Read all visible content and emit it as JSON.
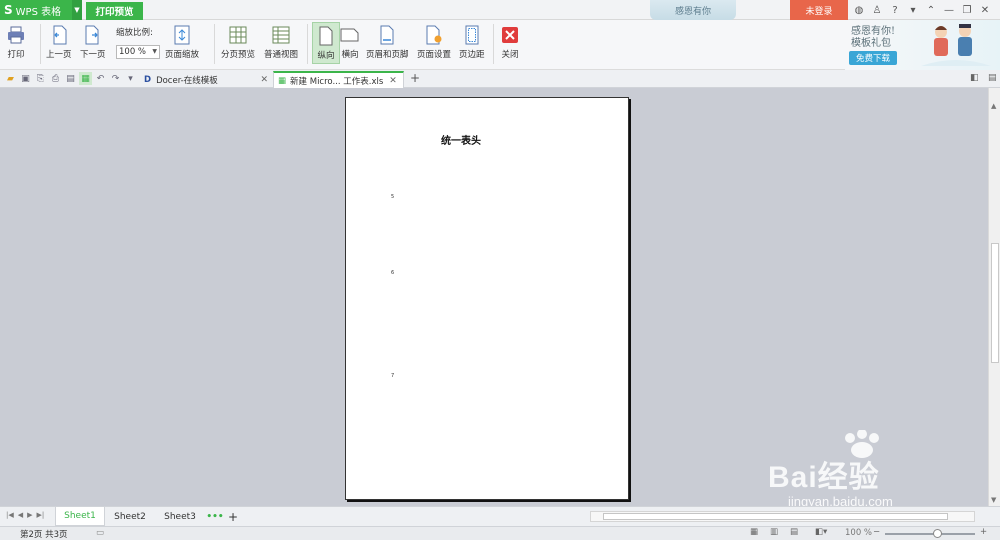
{
  "titlebar": {
    "app_name": "WPS 表格",
    "app_logo": "S",
    "tab_print_preview": "打印预览",
    "banner": "感恩有你",
    "login": "未登录",
    "window_icons": [
      "skin-icon",
      "shirt-icon",
      "help-icon",
      "menu-icon",
      "collapse-icon",
      "minimize-icon",
      "restore-icon",
      "close-icon"
    ]
  },
  "ribbon": {
    "print": "打印",
    "prev_page": "上一页",
    "next_page": "下一页",
    "zoom_label": "缩放比例:",
    "zoom_value": "100 %",
    "page_zoom": "页面缩放",
    "page_break_preview": "分页预览",
    "normal_view": "普通视图",
    "portrait": "纵向",
    "landscape": "横向",
    "header_footer": "页眉和页脚",
    "page_setup": "页面设置",
    "margins": "页边距",
    "close": "关闭"
  },
  "ad": {
    "line1": "感恩有你!",
    "line2": "模板礼包",
    "button": "免费下载"
  },
  "tabs": [
    {
      "label": "Docer-在线模板"
    },
    {
      "label": "新建 Micro... 工作表.xls"
    }
  ],
  "page": {
    "title": "统一表头",
    "row_numbers": [
      "5",
      "6",
      "7"
    ]
  },
  "sheets": [
    "Sheet1",
    "Sheet2",
    "Sheet3"
  ],
  "sheet_more": "•••",
  "sheet_add": "+",
  "status": {
    "page_info": "第2页 共3页",
    "zoom": "100 %"
  },
  "watermark": {
    "logo": "Bai经验",
    "url": "jingyan.baidu.com"
  },
  "colors": {
    "accent_green": "#3bb54a",
    "login_orange": "#e8664a"
  }
}
